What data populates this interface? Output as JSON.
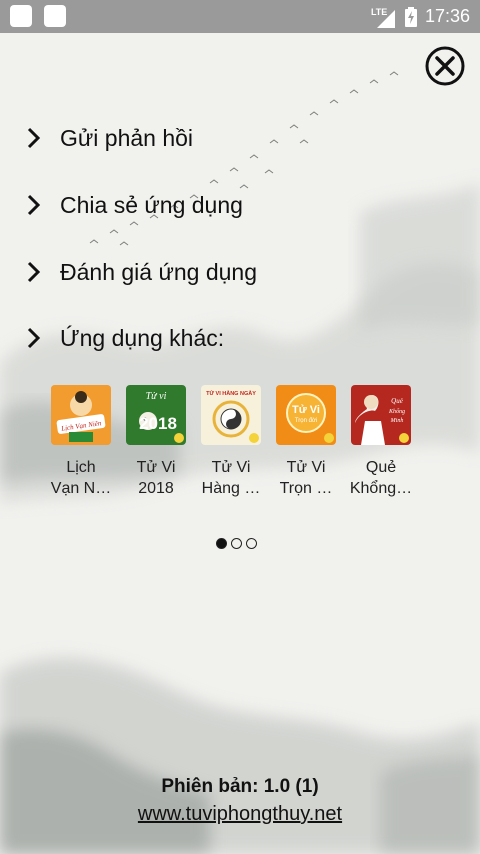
{
  "status_bar": {
    "network": "LTE",
    "time": "17:36"
  },
  "menu": [
    {
      "label": "Gửi phản hồi"
    },
    {
      "label": "Chia sẻ ứng dụng"
    },
    {
      "label": "Đánh giá ứng dụng"
    },
    {
      "label": "Ứng dụng khác:"
    }
  ],
  "apps": [
    {
      "line1": "Lịch",
      "line2": "Vạn N…",
      "icon": "lich-van-nien-icon",
      "icon_text": "Lịch Vạn Niên",
      "color": "#f19a2a"
    },
    {
      "line1": "Tử Vi",
      "line2": "2018",
      "icon": "tu-vi-2018-icon",
      "icon_text": "2018",
      "icon_text2": "Tử vi",
      "color": "#2f7a2c"
    },
    {
      "line1": "Tử Vi",
      "line2": "Hàng …",
      "icon": "tu-vi-hang-ngay-icon",
      "icon_text": "TỬ VI HÀNG NGÀY",
      "color": "#f5efd8"
    },
    {
      "line1": "Tử Vi",
      "line2": "Trọn …",
      "icon": "tu-vi-tron-doi-icon",
      "icon_text": "Tử Vi",
      "icon_text2": "Trọn đời",
      "color": "#f08a14"
    },
    {
      "line1": "Quẻ",
      "line2": "Khổng…",
      "icon": "que-khong-minh-icon",
      "icon_text": "Quẻ Khổng Minh",
      "color": "#b3261e"
    }
  ],
  "pager": {
    "count": 3,
    "active": 0
  },
  "footer": {
    "version": "Phiên bản: 1.0 (1)",
    "website": "www.tuviphongthuy.net"
  }
}
